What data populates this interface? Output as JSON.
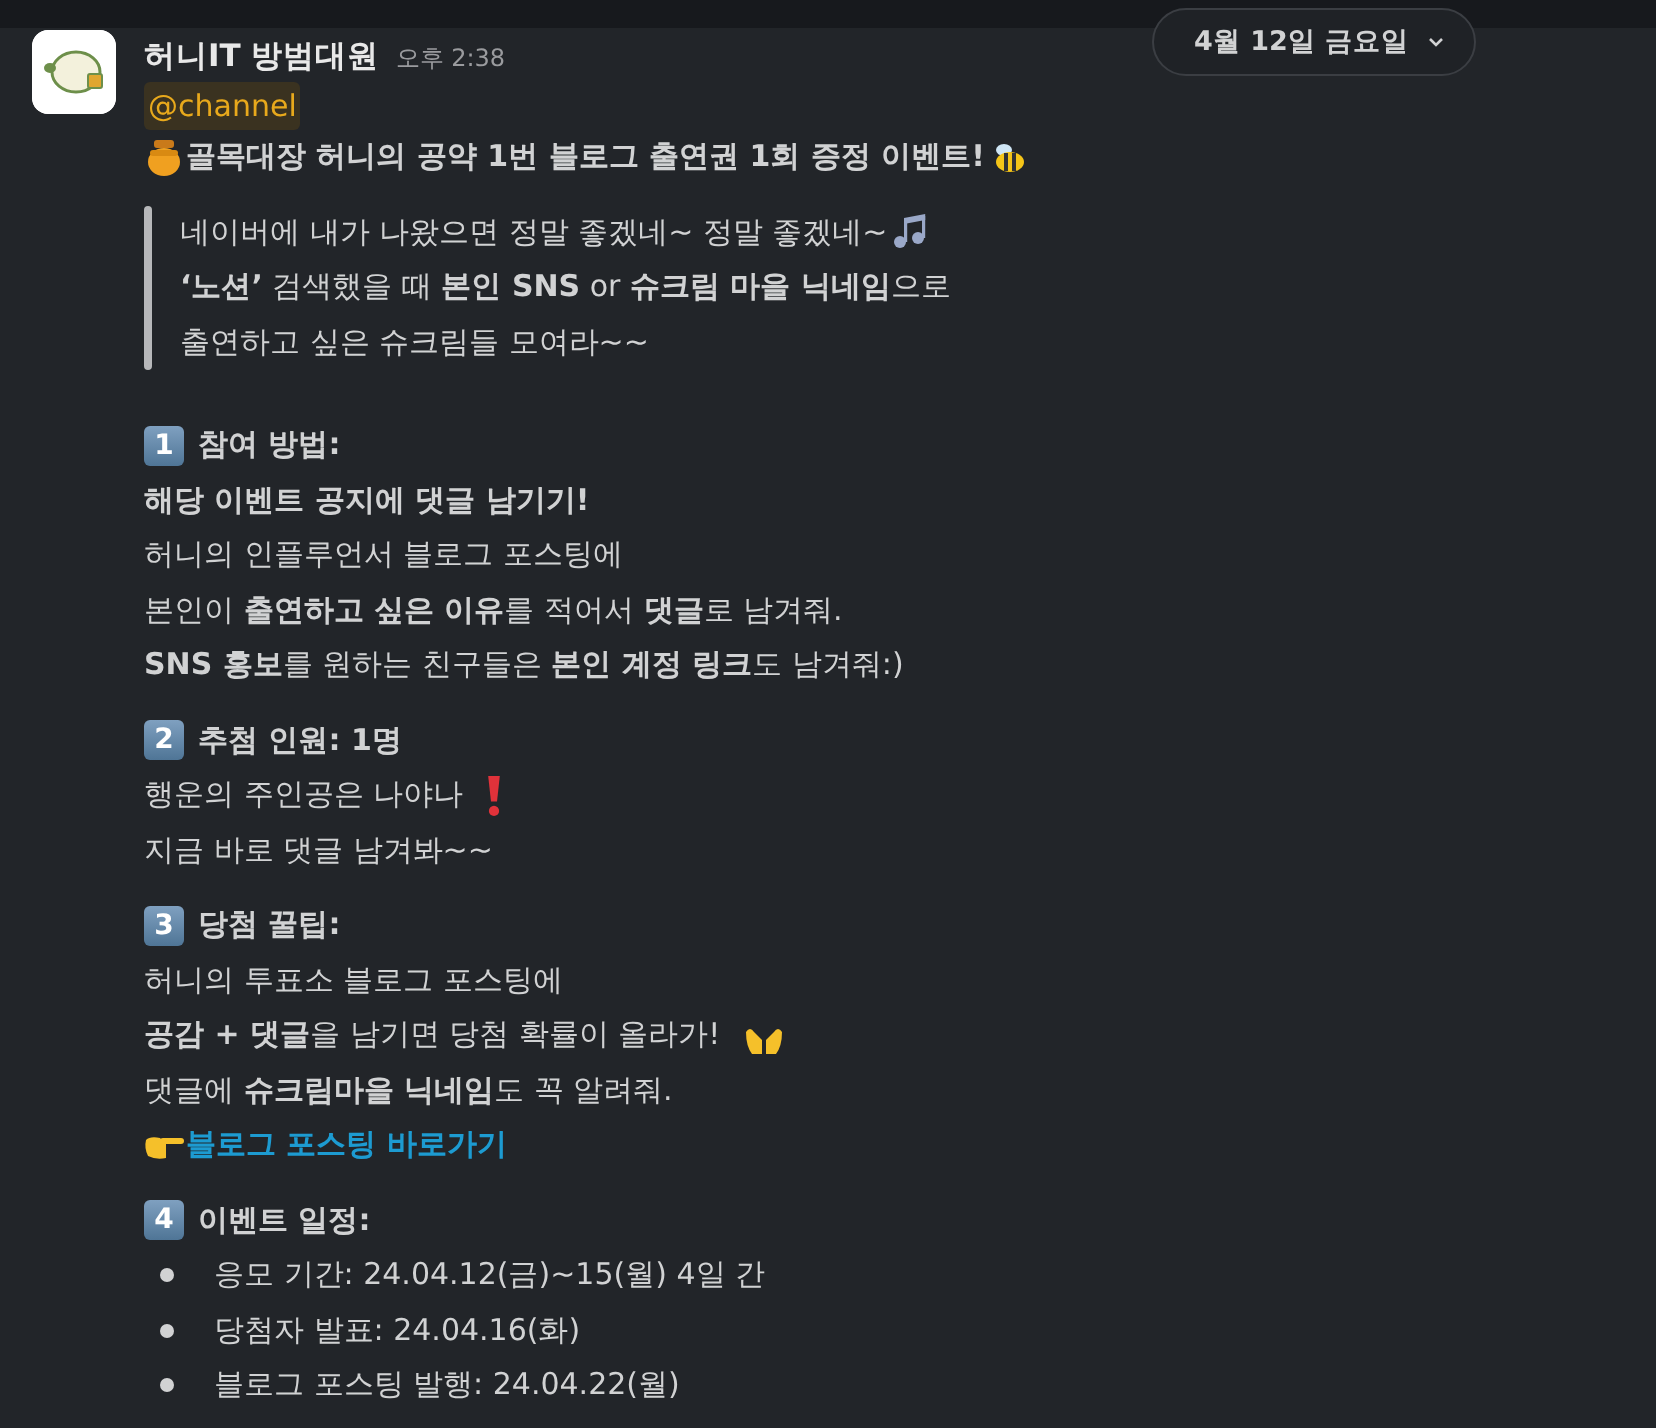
{
  "header": {
    "sender": "허니IT 방범대원",
    "time": "오후 2:38"
  },
  "date_pill": {
    "label": "4월 12일 금요일"
  },
  "mention": "@channel",
  "headline": "골목대장 허니의 공약 1번 블로그 출연권 1회 증정 이벤트!",
  "quote": [
    "네이버에 내가 나왔으면 정말 좋겠네~ 정말 좋겠네~",
    "**‘노션’** 검색했을 때 **본인 SNS** or **슈크림 마을 닉네임**으로",
    "출연하고 싶은 슈크림들 모여라~~"
  ],
  "sections": [
    {
      "number": "1",
      "title": "참여 방법:",
      "lines": [
        {
          "kind": "bold",
          "text": "해당 이벤트 공지에 댓글 남기기!"
        },
        {
          "kind": "text",
          "text": "허니의 인플루언서 블로그 포스팅에"
        },
        {
          "kind": "text",
          "text": "본인이 **출연하고 싶은 이유**를 적어서 **댓글**로 남겨줘."
        },
        {
          "kind": "text",
          "text": "**SNS 홍보**를 원하는 친구들은 **본인 계정 링크**도 남겨줘:)"
        }
      ]
    },
    {
      "number": "2",
      "title": "추첨 인원: 1명",
      "lines": [
        {
          "kind": "text",
          "text": "행운의 주인공은 나야나"
        },
        {
          "kind": "text",
          "text": "지금 바로 댓글 남겨봐~~"
        }
      ]
    },
    {
      "number": "3",
      "title": "당첨 꿀팁:",
      "lines": [
        {
          "kind": "text",
          "text": "허니의 투표소 블로그 포스팅에"
        },
        {
          "kind": "text",
          "text": "**공감 + 댓글**을 남기면 당첨 확률이 올라가!"
        },
        {
          "kind": "text",
          "text": "댓글에 **슈크림마을 닉네임**도 꼭 알려줘."
        },
        {
          "kind": "link",
          "text": "블로그 포스팅 바로가기"
        }
      ]
    },
    {
      "number": "4",
      "title": "이벤트 일정:",
      "lines": [
        {
          "kind": "bullet",
          "text": "응모 기간: 24.04.12(금)~15(월) 4일 간"
        },
        {
          "kind": "bullet",
          "text": "당첨자 발표: 24.04.16(화)"
        },
        {
          "kind": "bullet",
          "text": "블로그 포스팅 발행: 24.04.22(월)"
        }
      ]
    }
  ]
}
